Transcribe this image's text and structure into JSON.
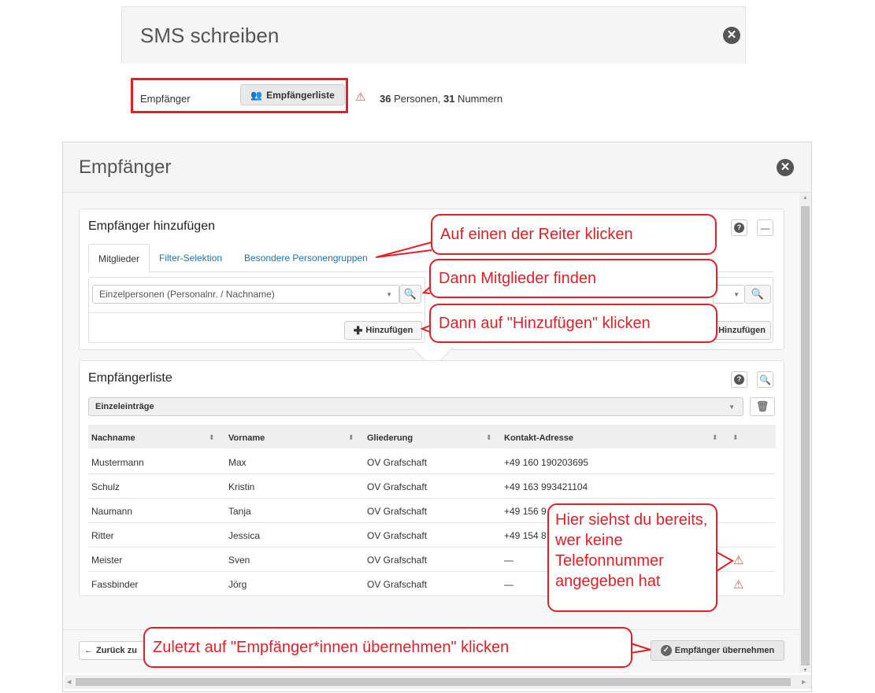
{
  "sms": {
    "title": "SMS schreiben",
    "recipient_label": "Empfänger",
    "recipient_list_button": "Empfängerliste",
    "count_persons": "36",
    "count_persons_label": " Personen, ",
    "count_numbers": "31",
    "count_numbers_label": " Nummern"
  },
  "dialog": {
    "title": "Empfänger",
    "add_panel": {
      "title": "Empfänger hinzufügen",
      "tabs": [
        "Mitglieder",
        "Filter-Selektion",
        "Besondere Personengruppen"
      ],
      "search_placeholder": "Einzelpersonen (Personalnr. / Nachname)",
      "add_button": "Hinzufügen",
      "add_button_right": "Hinzufügen"
    },
    "list_panel": {
      "title": "Empfängerliste",
      "group_select": "Einzeleinträge",
      "columns": [
        "Nachname",
        "Vorname",
        "Gliederung",
        "Kontakt-Adresse"
      ],
      "rows": [
        {
          "last": "Mustermann",
          "first": "Max",
          "unit": "OV Grafschaft",
          "contact": "+49 160 190203695",
          "warn": false
        },
        {
          "last": "Schulz",
          "first": "Kristin",
          "unit": "OV Grafschaft",
          "contact": "+49 163 993421104",
          "warn": false
        },
        {
          "last": "Naumann",
          "first": "Tanja",
          "unit": "OV Grafschaft",
          "contact": "+49 156 9",
          "warn": false
        },
        {
          "last": "Ritter",
          "first": "Jessica",
          "unit": "OV Grafschaft",
          "contact": "+49 154 8",
          "warn": false
        },
        {
          "last": "Meister",
          "first": "Sven",
          "unit": "OV Grafschaft",
          "contact": "—",
          "warn": true
        },
        {
          "last": "Fassbinder",
          "first": "Jörg",
          "unit": "OV Grafschaft",
          "contact": "—",
          "warn": true
        }
      ]
    },
    "footer": {
      "back_button": "Zurück zu",
      "accept_button": "Empfänger übernehmen"
    }
  },
  "annotations": {
    "tabs": "Auf einen der Reiter klicken",
    "find": "Dann Mitglieder finden",
    "add": "Dann auf \"Hinzufügen\" klicken",
    "nophone": "Hier siehst du bereits, wer keine Telefonnummer angegeben hat",
    "accept": "Zuletzt auf \"Empfänger*innen übernehmen\" klicken"
  },
  "colors": {
    "annotation": "#e31e24",
    "link": "#1a73b8",
    "warning": "#d9534f"
  }
}
